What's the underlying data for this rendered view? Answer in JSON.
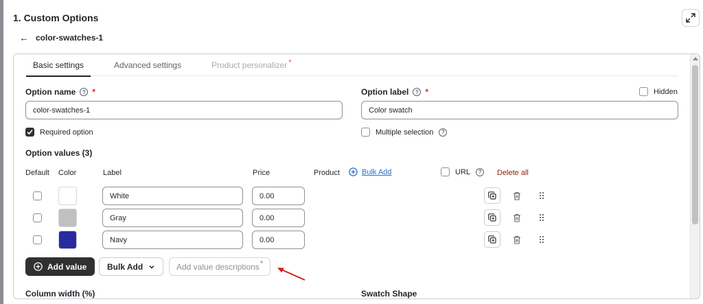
{
  "page": {
    "title": "1. Custom Options",
    "back_label": "color-swatches-1"
  },
  "tabs": [
    {
      "label": "Basic settings",
      "state": "active"
    },
    {
      "label": "Advanced settings",
      "state": "normal"
    },
    {
      "label": "Product personalizer",
      "state": "disabled",
      "badge": "*"
    }
  ],
  "option_name": {
    "label": "Option name",
    "required_mark": "*",
    "value": "color-swatches-1"
  },
  "option_label": {
    "label": "Option label",
    "required_mark": "*",
    "value": "Color swatch"
  },
  "hidden": {
    "label": "Hidden",
    "checked": false
  },
  "required_option": {
    "label": "Required option",
    "checked": true
  },
  "multiple_selection": {
    "label": "Multiple selection",
    "checked": false
  },
  "option_values": {
    "title": "Option values (3)",
    "columns": {
      "default": "Default",
      "color": "Color",
      "label": "Label",
      "price": "Price",
      "product": "Product"
    },
    "bulk_add_link": "Bulk Add",
    "url_label": "URL",
    "delete_all": "Delete all",
    "rows": [
      {
        "label": "White",
        "price": "0.00",
        "color": "#ffffff"
      },
      {
        "label": "Gray",
        "price": "0.00",
        "color": "#c0c0c0"
      },
      {
        "label": "Navy",
        "price": "0.00",
        "color": "#2a2aa0"
      }
    ]
  },
  "actions": {
    "add_value": "Add value",
    "bulk_add": "Bulk Add",
    "add_descriptions": "Add value descriptions",
    "add_descriptions_badge": "*"
  },
  "footer_labels": {
    "column_width": "Column width (%)",
    "swatch_shape": "Swatch Shape"
  },
  "colors": {
    "accent_link": "#2c6ecb",
    "danger": "#8e1f0b",
    "badge": "#d95fd1",
    "annotation_arrow": "#d0201a"
  }
}
